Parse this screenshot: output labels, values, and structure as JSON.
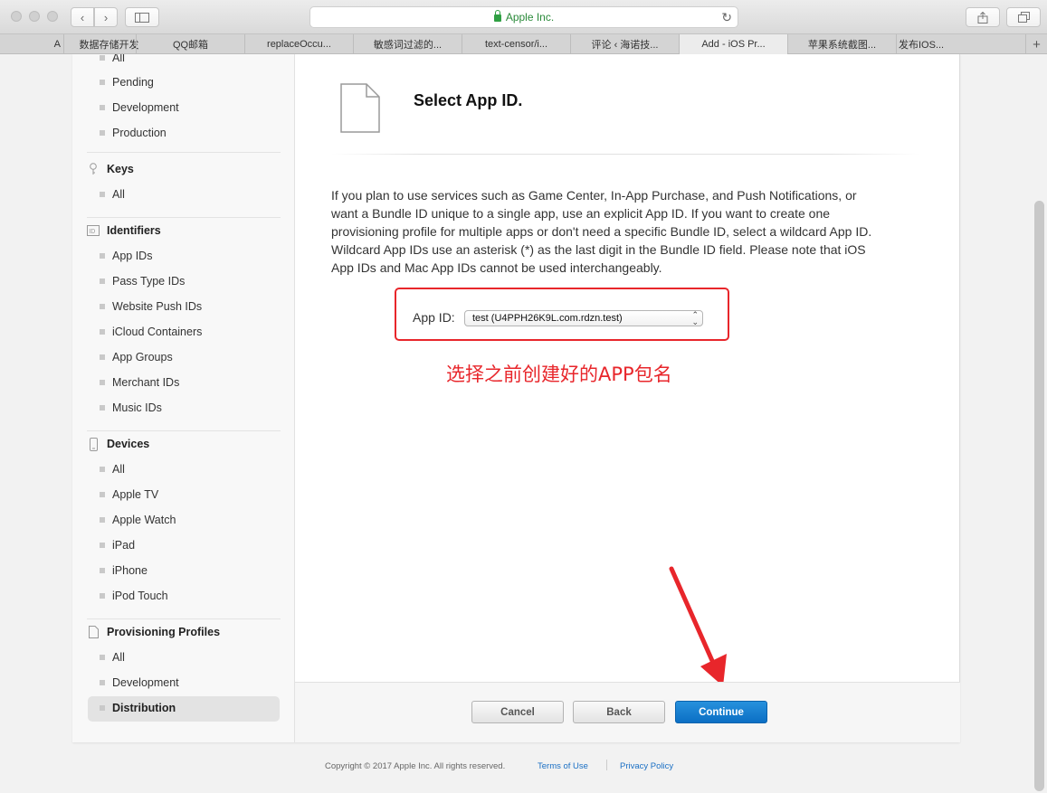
{
  "browser": {
    "address": "Apple Inc.",
    "tabs": [
      {
        "label": "A"
      },
      {
        "label": "数据存储开发"
      },
      {
        "label": "QQ邮箱"
      },
      {
        "label": "replaceOccu..."
      },
      {
        "label": "敏感词过滤的..."
      },
      {
        "label": "text-censor/i..."
      },
      {
        "label": "评论 ‹ 海诺技..."
      },
      {
        "label": "Add - iOS Pr..."
      },
      {
        "label": "苹果系统截图..."
      },
      {
        "label": "发布IOS..."
      }
    ]
  },
  "sidebar": {
    "certificates": [
      "All",
      "Pending",
      "Development",
      "Production"
    ],
    "keys": {
      "title": "Keys",
      "items": [
        "All"
      ]
    },
    "identifiers": {
      "title": "Identifiers",
      "items": [
        "App IDs",
        "Pass Type IDs",
        "Website Push IDs",
        "iCloud Containers",
        "App Groups",
        "Merchant IDs",
        "Music IDs"
      ]
    },
    "devices": {
      "title": "Devices",
      "items": [
        "All",
        "Apple TV",
        "Apple Watch",
        "iPad",
        "iPhone",
        "iPod Touch"
      ]
    },
    "profiles": {
      "title": "Provisioning Profiles",
      "items": [
        "All",
        "Development",
        "Distribution"
      ]
    }
  },
  "main": {
    "title": "Select App ID.",
    "description": "If you plan to use services such as Game Center, In-App Purchase, and Push Notifications, or want a Bundle ID unique to a single app, use an explicit App ID. If you want to create one provisioning profile for multiple apps or don't need a specific Bundle ID, select a wildcard App ID. Wildcard App IDs use an asterisk (*) as the last digit in the Bundle ID field. Please note that iOS App IDs and Mac App IDs cannot be used interchangeably.",
    "app_id_label": "App ID:",
    "app_id_value": "test (U4PPH26K9L.com.rdzn.test)",
    "annotation": "选择之前创建好的APP包名"
  },
  "buttons": {
    "cancel": "Cancel",
    "back": "Back",
    "continue": "Continue"
  },
  "footer": {
    "copyright": "Copyright © 2017 Apple Inc. All rights reserved.",
    "terms": "Terms of Use",
    "privacy": "Privacy Policy"
  },
  "colors": {
    "accent": "#0b6fc4",
    "annotation": "#e8262b",
    "secure": "#2fa043"
  }
}
